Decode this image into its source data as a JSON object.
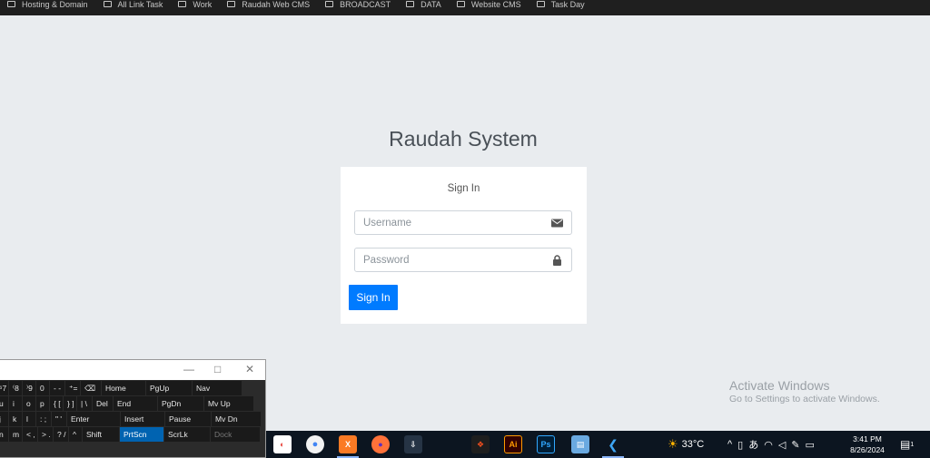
{
  "bookmarks": [
    "Hosting & Domain",
    "All Link Task",
    "Work",
    "Raudah Web CMS",
    "BROADCAST",
    "DATA",
    "Website CMS",
    "Task Day"
  ],
  "login": {
    "title": "Raudah System",
    "card_heading": "Sign In",
    "username_placeholder": "Username",
    "password_placeholder": "Password",
    "submit_label": "Sign In",
    "accent": "#007bff"
  },
  "watermark": {
    "line1": "Activate Windows",
    "line2": "Go to Settings to activate Windows."
  },
  "osk": {
    "rows": [
      [
        {
          "t": "⁶7"
        },
        {
          "t": "⁽8"
        },
        {
          "t": "⁾9"
        },
        {
          "t": "0"
        },
        {
          "t": "- -"
        },
        {
          "t": "⁺="
        },
        {
          "t": "⌫"
        },
        {
          "t": "Home"
        },
        {
          "t": "PgUp"
        },
        {
          "t": "Nav"
        }
      ],
      [
        {
          "t": "u"
        },
        {
          "t": "i"
        },
        {
          "t": "o"
        },
        {
          "t": "p"
        },
        {
          "t": "{ ["
        },
        {
          "t": "} ]"
        },
        {
          "t": "| \\"
        },
        {
          "t": "Del"
        },
        {
          "t": "End"
        },
        {
          "t": "PgDn"
        },
        {
          "t": "Mv Up"
        }
      ],
      [
        {
          "t": "j"
        },
        {
          "t": "k"
        },
        {
          "t": "l"
        },
        {
          "t": ": ;"
        },
        {
          "t": "\" '"
        },
        {
          "t": "Enter"
        },
        {
          "t": "Insert"
        },
        {
          "t": "Pause"
        },
        {
          "t": "Mv Dn"
        }
      ],
      [
        {
          "t": "n"
        },
        {
          "t": "m"
        },
        {
          "t": "< ,"
        },
        {
          "t": "> ."
        },
        {
          "t": "? /"
        },
        {
          "t": "^"
        },
        {
          "t": "Shift"
        },
        {
          "t": "PrtScn"
        },
        {
          "t": "ScrLk"
        },
        {
          "t": "Dock"
        }
      ]
    ]
  },
  "taskbar": {
    "apps": [
      "Figma-like",
      "Chrome",
      "Chrome",
      "XAMPP",
      "Firefox",
      "Installer",
      "Figma",
      "Illustrator",
      "Photoshop",
      "Notepad",
      "VS Code"
    ],
    "weather_temp": "33°C",
    "time": "3:41 PM",
    "date": "8/26/2024",
    "notification_count": "1"
  },
  "colors": {
    "background": "#e9ecef",
    "button": "#007bff",
    "taskbar": "#0c1520"
  }
}
